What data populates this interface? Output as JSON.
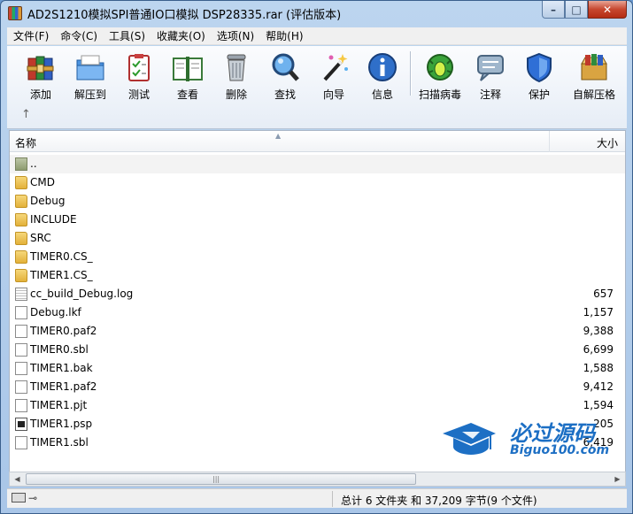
{
  "window": {
    "title": "AD2S1210模拟SPI普通IO口模拟 DSP28335.rar (评估版本)",
    "controls": {
      "minimize": "–",
      "maximize": "□",
      "close": "✕"
    }
  },
  "menu": [
    "文件(F)",
    "命令(C)",
    "工具(S)",
    "收藏夹(O)",
    "选项(N)",
    "帮助(H)"
  ],
  "toolbar": [
    {
      "label": "添加",
      "icon": "add-archive-icon"
    },
    {
      "label": "解压到",
      "icon": "extract-to-icon"
    },
    {
      "label": "测试",
      "icon": "test-icon"
    },
    {
      "label": "查看",
      "icon": "view-book-icon"
    },
    {
      "label": "删除",
      "icon": "trash-icon"
    },
    {
      "label": "查找",
      "icon": "magnifier-icon"
    },
    {
      "label": "向导",
      "icon": "wizard-wand-icon"
    },
    {
      "label": "信息",
      "icon": "info-icon"
    },
    {
      "label": "扫描病毒",
      "icon": "virus-scan-icon"
    },
    {
      "label": "注释",
      "icon": "comment-icon"
    },
    {
      "label": "保护",
      "icon": "shield-icon"
    },
    {
      "label": "自解压格",
      "icon": "sfx-box-icon"
    }
  ],
  "nav": {
    "up_arrow": "↑"
  },
  "list": {
    "columns": {
      "name": "名称",
      "size": "大小"
    },
    "rows": [
      {
        "name": "..",
        "size": "",
        "type": "up"
      },
      {
        "name": "CMD",
        "size": "",
        "type": "folder"
      },
      {
        "name": "Debug",
        "size": "",
        "type": "folder"
      },
      {
        "name": "INCLUDE",
        "size": "",
        "type": "folder"
      },
      {
        "name": "SRC",
        "size": "",
        "type": "folder"
      },
      {
        "name": "TIMER0.CS_",
        "size": "",
        "type": "folder"
      },
      {
        "name": "TIMER1.CS_",
        "size": "",
        "type": "folder"
      },
      {
        "name": "cc_build_Debug.log",
        "size": "657",
        "type": "log"
      },
      {
        "name": "Debug.lkf",
        "size": "1,157",
        "type": "file"
      },
      {
        "name": "TIMER0.paf2",
        "size": "9,388",
        "type": "file"
      },
      {
        "name": "TIMER0.sbl",
        "size": "6,699",
        "type": "file"
      },
      {
        "name": "TIMER1.bak",
        "size": "1,588",
        "type": "file"
      },
      {
        "name": "TIMER1.paf2",
        "size": "9,412",
        "type": "file"
      },
      {
        "name": "TIMER1.pjt",
        "size": "1,594",
        "type": "file"
      },
      {
        "name": "TIMER1.psp",
        "size": "205",
        "type": "psp"
      },
      {
        "name": "TIMER1.sbl",
        "size": "6,419",
        "type": "file"
      }
    ]
  },
  "scrollbar": {
    "left": "◀",
    "right": "▶",
    "grip": "|||"
  },
  "status": {
    "summary": "总计 6 文件夹 和 37,209 字节(9 个文件)",
    "key_icon": "⊸"
  },
  "watermark": {
    "title": "必过源码",
    "url": "Biguo100.com"
  },
  "colors": {
    "watermark_blue": "#1d6fc4",
    "titlebar": "#bcd5ef"
  }
}
